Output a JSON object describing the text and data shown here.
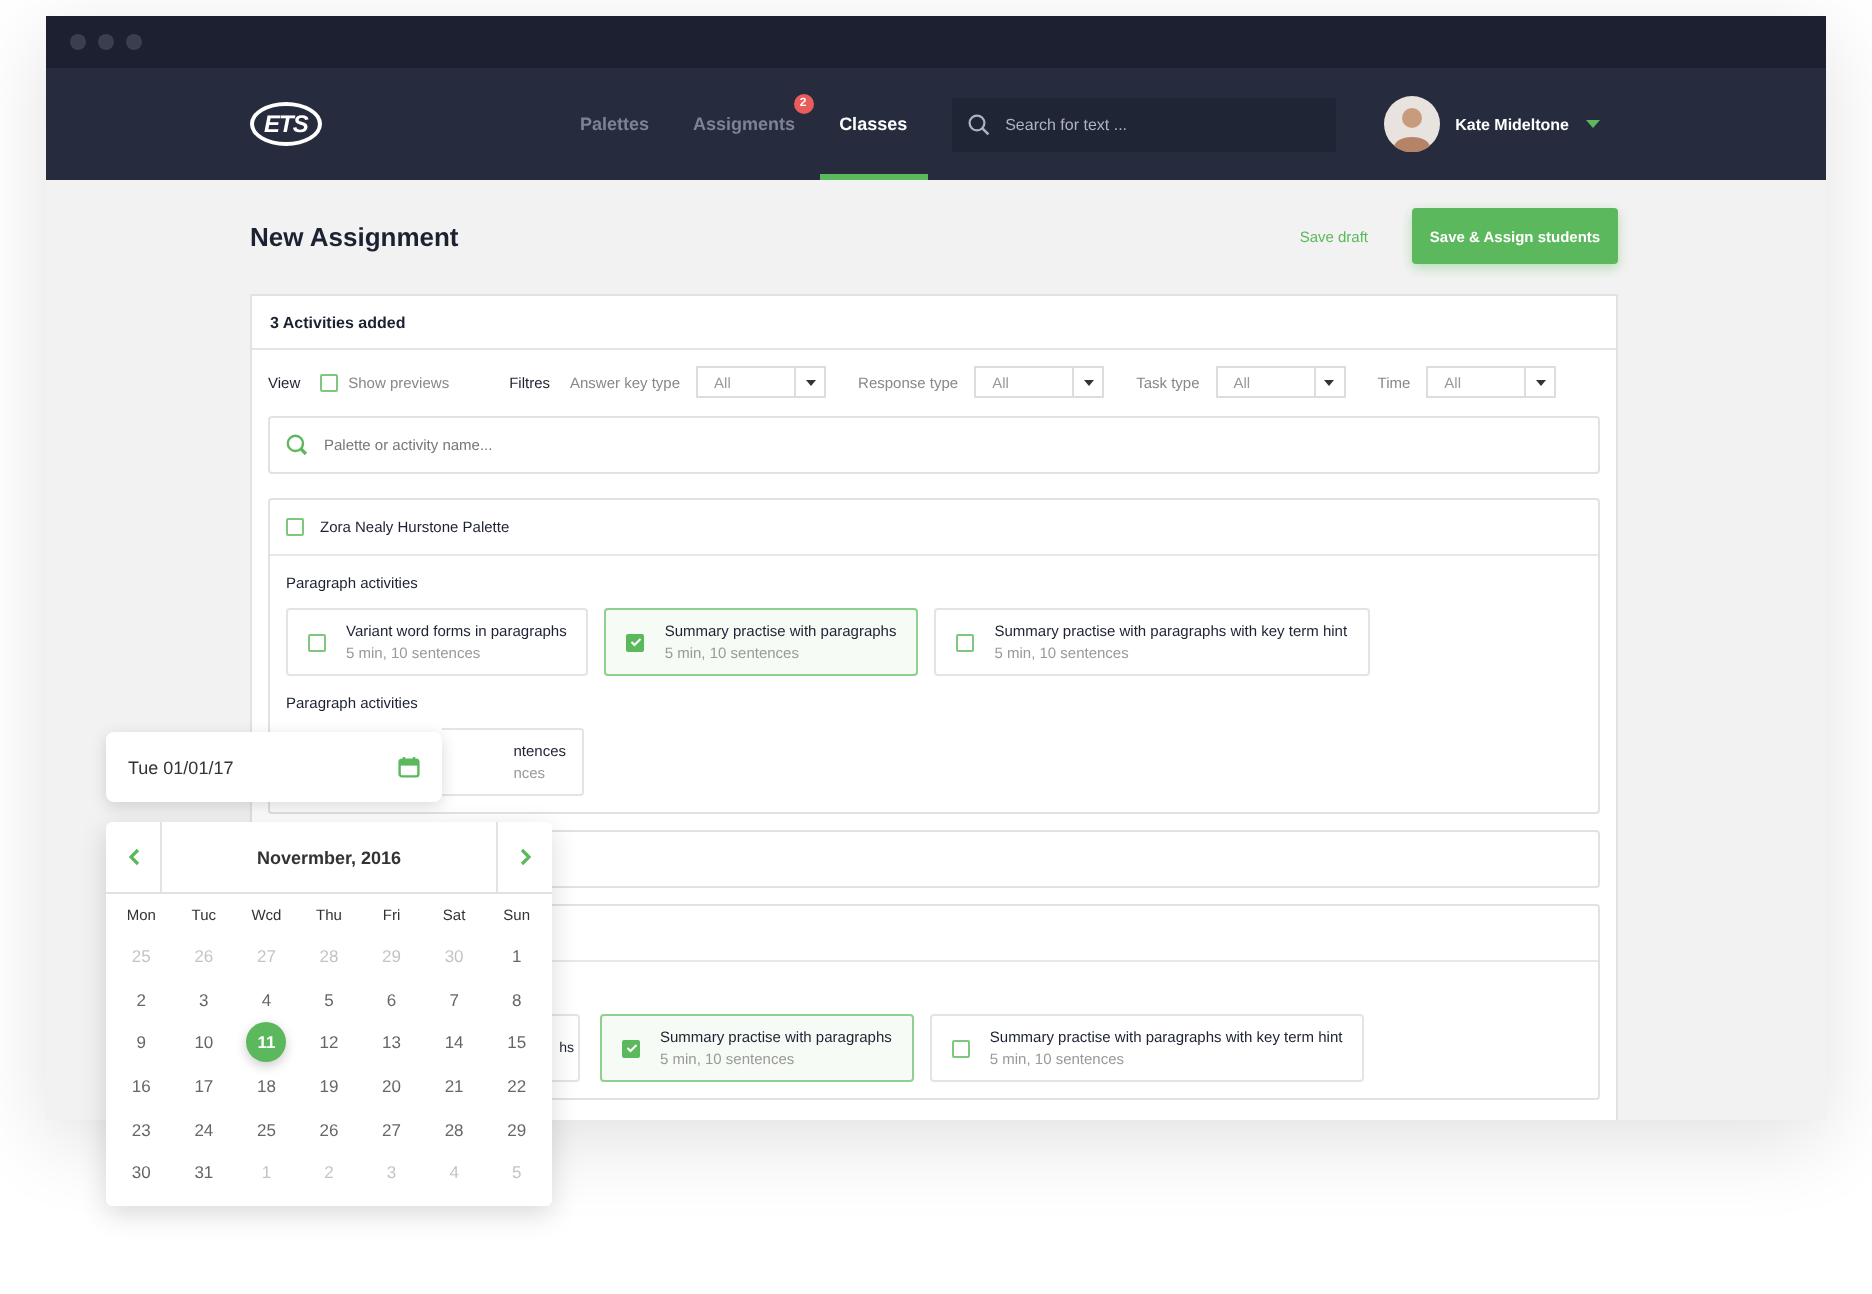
{
  "nav": {
    "logo": "ETS",
    "tabs": [
      {
        "label": "Palettes",
        "selected": false
      },
      {
        "label": "Assigments",
        "selected": false,
        "badge": "2"
      },
      {
        "label": "Classes",
        "selected": true
      }
    ],
    "search": {
      "placeholder": "Search for text ..."
    },
    "user": {
      "name": "Kate Mideltone"
    }
  },
  "page": {
    "title": "New Assignment",
    "save_draft": "Save draft",
    "primary_button": "Save & Assign students"
  },
  "panel": {
    "heading": "3 Activities added",
    "view_label": "View",
    "show_previews": {
      "label": "Show previews",
      "checked": false
    },
    "filters_label": "Filtres",
    "filters": [
      {
        "label": "Answer key type",
        "value": "All"
      },
      {
        "label": "Response type",
        "value": "All"
      },
      {
        "label": "Task type",
        "value": "All"
      },
      {
        "label": "Time",
        "value": "All"
      }
    ],
    "search": {
      "placeholder": "Palette or activity name..."
    },
    "palettes": [
      {
        "name": "Zora Nealy Hurstone Palette",
        "checked": false,
        "expanded": true,
        "sections": [
          {
            "title": "Paragraph activities",
            "activities": [
              {
                "kind": "full",
                "title": "Variant word forms in paragraphs",
                "meta": "5 min, 10 sentences",
                "checked": false
              },
              {
                "kind": "full",
                "title": "Summary practise with paragraphs",
                "meta": "5 min, 10 sentences",
                "checked": true
              },
              {
                "kind": "full",
                "title": "Summary practise with paragraphs with key term hint",
                "meta": "5 min, 10 sentences",
                "checked": false
              }
            ]
          },
          {
            "title": "Paragraph activities",
            "activities": [
              {
                "kind": "clipped",
                "title": "ntences",
                "meta": "nces"
              }
            ]
          }
        ]
      },
      {
        "expanded": false
      },
      {
        "expanded": true,
        "sections": [
          {
            "activities": [
              {
                "kind": "sliver",
                "title": "hs"
              },
              {
                "kind": "full",
                "title": "Summary practise with paragraphs",
                "meta": "5 min, 10 sentences",
                "checked": true
              },
              {
                "kind": "full",
                "title": "Summary practise with paragraphs with key term hint",
                "meta": "5 min, 10 sentences",
                "checked": false
              }
            ]
          }
        ]
      }
    ]
  },
  "date_picker": {
    "value": "Tue 01/01/17",
    "month": "Novermber, 2016",
    "weekdays": [
      "Mon",
      "Tuc",
      "Wcd",
      "Thu",
      "Fri",
      "Sat",
      "Sun"
    ],
    "days": [
      {
        "label": "25",
        "muted": true
      },
      {
        "label": "26",
        "muted": true
      },
      {
        "label": "27",
        "muted": true
      },
      {
        "label": "28",
        "muted": true
      },
      {
        "label": "29",
        "muted": true
      },
      {
        "label": "30",
        "muted": true
      },
      {
        "label": "1",
        "muted": false
      },
      {
        "label": "2",
        "muted": false
      },
      {
        "label": "3",
        "muted": false
      },
      {
        "label": "4",
        "muted": false
      },
      {
        "label": "5",
        "muted": false
      },
      {
        "label": "6",
        "muted": false
      },
      {
        "label": "7",
        "muted": false
      },
      {
        "label": "8",
        "muted": false
      },
      {
        "label": "9",
        "muted": false
      },
      {
        "label": "10",
        "muted": false
      },
      {
        "label": "11",
        "muted": false,
        "selected": true
      },
      {
        "label": "12",
        "muted": false
      },
      {
        "label": "13",
        "muted": false
      },
      {
        "label": "14",
        "muted": false
      },
      {
        "label": "15",
        "muted": false
      },
      {
        "label": "16",
        "muted": false
      },
      {
        "label": "17",
        "muted": false
      },
      {
        "label": "18",
        "muted": false
      },
      {
        "label": "19",
        "muted": false
      },
      {
        "label": "20",
        "muted": false
      },
      {
        "label": "21",
        "muted": false
      },
      {
        "label": "22",
        "muted": false
      },
      {
        "label": "23",
        "muted": false
      },
      {
        "label": "24",
        "muted": false
      },
      {
        "label": "25",
        "muted": false
      },
      {
        "label": "26",
        "muted": false
      },
      {
        "label": "27",
        "muted": false
      },
      {
        "label": "28",
        "muted": false
      },
      {
        "label": "29",
        "muted": false
      },
      {
        "label": "30",
        "muted": false
      },
      {
        "label": "31",
        "muted": false
      },
      {
        "label": "1",
        "muted": true
      },
      {
        "label": "2",
        "muted": true
      },
      {
        "label": "3",
        "muted": true
      },
      {
        "label": "4",
        "muted": true
      },
      {
        "label": "5",
        "muted": true
      }
    ]
  }
}
